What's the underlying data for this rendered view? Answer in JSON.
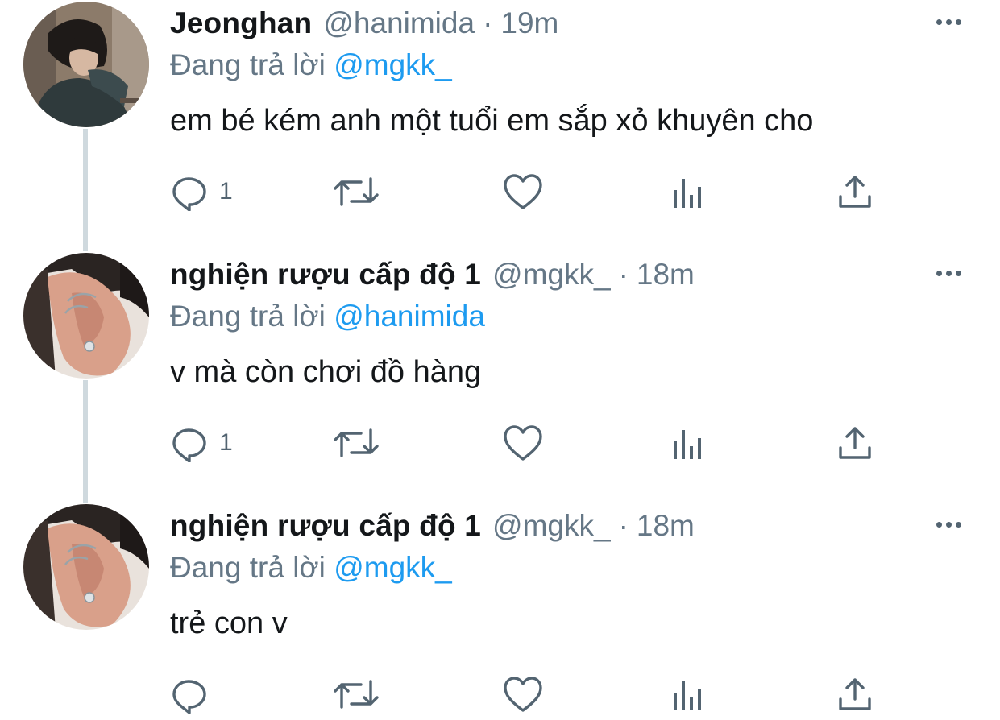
{
  "tweets": [
    {
      "display_name": "Jeonghan",
      "handle": "@hanimida",
      "separator": "·",
      "time": "19m",
      "reply_prefix": "Đang trả lời",
      "reply_to": "@mgkk_",
      "text": "em bé kém anh một tuổi em sắp xỏ khuyên cho",
      "reply_count": "1"
    },
    {
      "display_name": "nghiện rượu cấp độ 1",
      "handle": "@mgkk_",
      "separator": "·",
      "time": "18m",
      "reply_prefix": "Đang trả lời",
      "reply_to": "@hanimida",
      "text": "v mà còn chơi đồ hàng",
      "reply_count": "1"
    },
    {
      "display_name": "nghiện rượu cấp độ 1",
      "handle": "@mgkk_",
      "separator": "·",
      "time": "18m",
      "reply_prefix": "Đang trả lời",
      "reply_to": "@mgkk_",
      "text": "trẻ con v",
      "reply_count": ""
    }
  ],
  "icons": {
    "reply": "reply-icon",
    "retweet": "retweet-icon",
    "like": "like-icon",
    "analytics": "analytics-icon",
    "share": "share-icon",
    "more": "more-icon"
  },
  "colors": {
    "text_primary": "#14171a",
    "text_secondary": "#657786",
    "link": "#1d9bf0",
    "icon": "#536471",
    "thread_line": "#cfd9de",
    "background": "#ffffff"
  }
}
